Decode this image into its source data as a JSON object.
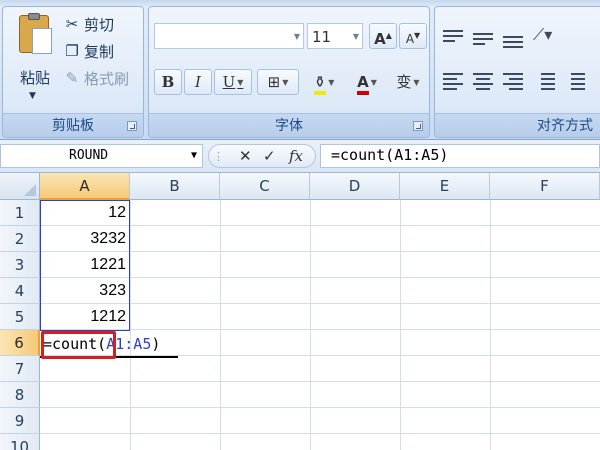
{
  "ribbon": {
    "clipboard": {
      "title": "剪贴板",
      "paste_label": "粘贴",
      "cut_label": "剪切",
      "copy_label": "复制",
      "format_painter_label": "格式刷"
    },
    "font": {
      "title": "字体",
      "font_name": "",
      "font_size": "11",
      "grow_label": "A",
      "shrink_label": "A",
      "bold_label": "B",
      "italic_label": "I",
      "underline_label": "U",
      "phonetic_label": "变"
    },
    "alignment": {
      "title": "对齐方式"
    }
  },
  "formula_bar": {
    "name_box": "ROUND",
    "formula": "=count(A1:A5)"
  },
  "grid": {
    "columns": [
      "A",
      "B",
      "C",
      "D",
      "E",
      "F"
    ],
    "rows": [
      "1",
      "2",
      "3",
      "4",
      "5",
      "6",
      "7",
      "8",
      "9",
      "10"
    ],
    "column_a_values": [
      "12",
      "3232",
      "1221",
      "323",
      "1212"
    ],
    "editing_cell": {
      "prefix": "=count(",
      "ref": "A1:A5",
      "suffix": ")"
    }
  },
  "colors": {
    "ribbon_bg": "#d4e3f5",
    "active_header": "#f7c978",
    "reference_blue": "#2f3fc6",
    "highlight_red": "#d02020"
  }
}
